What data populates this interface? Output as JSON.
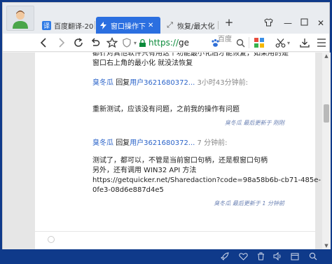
{
  "tabs": [
    {
      "label": "百度翻译-20",
      "icon": "translate-icon",
      "color": "#2f7be5"
    },
    {
      "label": "窗口操作下",
      "icon": "quicker-icon",
      "color": "#ffffff"
    },
    {
      "label": "恢复/最大化",
      "icon": "expand-icon",
      "color": "#555555"
    }
  ],
  "toolbar": {
    "url_scheme": "https://",
    "url_host": "ge",
    "baidu_label": "百度"
  },
  "posts": [
    {
      "line1": "都针对其他软件只有用这个功能最小化后才能恢复，如果用的是",
      "line2": "窗口右上角的最小化 就没法恢复"
    },
    {
      "author": "臭冬瓜",
      "reply_word": "回复",
      "reply_to": "用户3621680372...",
      "time": "3小时43分钟前:",
      "body": "重新测试，应该没有问题，之前我的操作有问题",
      "edited": "臭冬瓜 最后更新于 刚刚"
    },
    {
      "author": "臭冬瓜",
      "reply_word": "回复",
      "reply_to": "用户3621680372...",
      "time": "7 分钟前:",
      "body_lines": [
        "测试了，都可以，不管是当前窗口句柄，还是根窗口句柄",
        "另外，还有调用 WIN32 API 方法",
        "https://getquicker.net/Sharedaction?code=98a58b6b-cb71-485e-",
        "0fe3-08d6e887d4e5"
      ],
      "edited": "臭冬瓜 最后更新于 1 分钟前"
    }
  ],
  "colors": {
    "accent": "#2b6fe0",
    "link": "#2a63c9",
    "secure": "#0a8a3a"
  }
}
